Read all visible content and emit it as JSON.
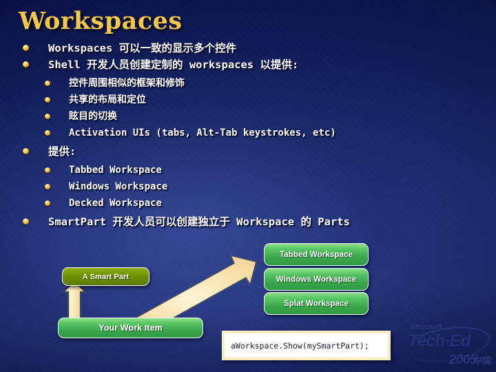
{
  "slide": {
    "title": "Workspaces",
    "accent_gold": "#f3c74a",
    "background_blue": "#1d2d72"
  },
  "bullets": [
    {
      "level": 1,
      "text": "Workspaces 可以一致的显示多个控件"
    },
    {
      "level": 1,
      "text": "Shell 开发人员创建定制的 workspaces 以提供:"
    },
    {
      "level": 2,
      "text": "控件周围相似的框架和修饰"
    },
    {
      "level": 2,
      "text": "共享的布局和定位"
    },
    {
      "level": 2,
      "text": "眩目的切换"
    },
    {
      "level": 2,
      "text": "Activation UIs (tabs, Alt-Tab keystrokes, etc)"
    },
    {
      "level": 1,
      "text": "提供:"
    },
    {
      "level": 2,
      "text": "Tabbed Workspace"
    },
    {
      "level": 2,
      "text": "Windows Workspace"
    },
    {
      "level": 2,
      "text": "Decked Workspace"
    },
    {
      "level": 1,
      "text": "SmartPart 开发人员可以创建独立于 Workspace 的 Parts"
    }
  ],
  "diagram": {
    "workspace_boxes": [
      {
        "label": "Tabbed Workspace",
        "color": "#3aa84c"
      },
      {
        "label": "Windows Workspace",
        "color": "#3aa84c"
      },
      {
        "label": "Splat Workspace",
        "color": "#3aa84c"
      }
    ],
    "smart_part_box": {
      "label": "A Smart Part",
      "color": "#6f9406"
    },
    "work_item_box": {
      "label": "Your Work Item",
      "color": "#3aa84c"
    },
    "arrow_color": "#fbe2a0"
  },
  "code_callout": {
    "code": "aWorkspace.Show(mySmartPart);"
  },
  "branding": {
    "microsoft": "Microsoft",
    "event": "Tech·Ed",
    "year": "2005",
    "region": "中国"
  }
}
